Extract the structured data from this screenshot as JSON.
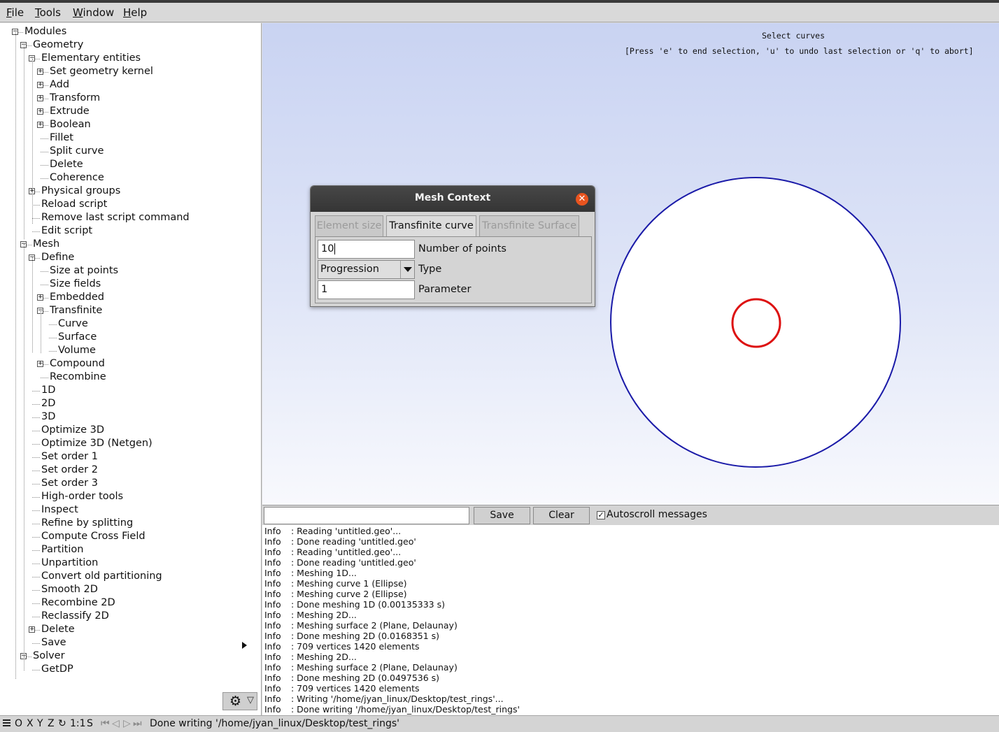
{
  "menu": [
    "File",
    "Tools",
    "Window",
    "Help"
  ],
  "tree": [
    {
      "label": "Modules",
      "depth": 0,
      "toggle": "minus"
    },
    {
      "label": "Geometry",
      "depth": 1,
      "toggle": "minus"
    },
    {
      "label": "Elementary entities",
      "depth": 2,
      "toggle": "minus"
    },
    {
      "label": "Set geometry kernel",
      "depth": 3,
      "toggle": "plus"
    },
    {
      "label": "Add",
      "depth": 3,
      "toggle": "plus"
    },
    {
      "label": "Transform",
      "depth": 3,
      "toggle": "plus"
    },
    {
      "label": "Extrude",
      "depth": 3,
      "toggle": "plus"
    },
    {
      "label": "Boolean",
      "depth": 3,
      "toggle": "plus"
    },
    {
      "label": "Fillet",
      "depth": 3,
      "toggle": ""
    },
    {
      "label": "Split curve",
      "depth": 3,
      "toggle": ""
    },
    {
      "label": "Delete",
      "depth": 3,
      "toggle": ""
    },
    {
      "label": "Coherence",
      "depth": 3,
      "toggle": ""
    },
    {
      "label": "Physical groups",
      "depth": 2,
      "toggle": "plus"
    },
    {
      "label": "Reload script",
      "depth": 2,
      "toggle": ""
    },
    {
      "label": "Remove last script command",
      "depth": 2,
      "toggle": ""
    },
    {
      "label": "Edit script",
      "depth": 2,
      "toggle": ""
    },
    {
      "label": "Mesh",
      "depth": 1,
      "toggle": "minus"
    },
    {
      "label": "Define",
      "depth": 2,
      "toggle": "minus"
    },
    {
      "label": "Size at points",
      "depth": 3,
      "toggle": ""
    },
    {
      "label": "Size fields",
      "depth": 3,
      "toggle": ""
    },
    {
      "label": "Embedded",
      "depth": 3,
      "toggle": "plus"
    },
    {
      "label": "Transfinite",
      "depth": 3,
      "toggle": "minus"
    },
    {
      "label": "Curve",
      "depth": 4,
      "toggle": ""
    },
    {
      "label": "Surface",
      "depth": 4,
      "toggle": ""
    },
    {
      "label": "Volume",
      "depth": 4,
      "toggle": ""
    },
    {
      "label": "Compound",
      "depth": 3,
      "toggle": "plus"
    },
    {
      "label": "Recombine",
      "depth": 3,
      "toggle": ""
    },
    {
      "label": "1D",
      "depth": 2,
      "toggle": ""
    },
    {
      "label": "2D",
      "depth": 2,
      "toggle": ""
    },
    {
      "label": "3D",
      "depth": 2,
      "toggle": ""
    },
    {
      "label": "Optimize 3D",
      "depth": 2,
      "toggle": ""
    },
    {
      "label": "Optimize 3D (Netgen)",
      "depth": 2,
      "toggle": ""
    },
    {
      "label": "Set order 1",
      "depth": 2,
      "toggle": ""
    },
    {
      "label": "Set order 2",
      "depth": 2,
      "toggle": ""
    },
    {
      "label": "Set order 3",
      "depth": 2,
      "toggle": ""
    },
    {
      "label": "High-order tools",
      "depth": 2,
      "toggle": ""
    },
    {
      "label": "Inspect",
      "depth": 2,
      "toggle": ""
    },
    {
      "label": "Refine by splitting",
      "depth": 2,
      "toggle": ""
    },
    {
      "label": "Compute Cross Field",
      "depth": 2,
      "toggle": ""
    },
    {
      "label": "Partition",
      "depth": 2,
      "toggle": ""
    },
    {
      "label": "Unpartition",
      "depth": 2,
      "toggle": ""
    },
    {
      "label": "Convert old partitioning",
      "depth": 2,
      "toggle": ""
    },
    {
      "label": "Smooth 2D",
      "depth": 2,
      "toggle": ""
    },
    {
      "label": "Recombine 2D",
      "depth": 2,
      "toggle": ""
    },
    {
      "label": "Reclassify 2D",
      "depth": 2,
      "toggle": ""
    },
    {
      "label": "Delete",
      "depth": 2,
      "toggle": "plus"
    },
    {
      "label": "Save",
      "depth": 2,
      "toggle": ""
    },
    {
      "label": "Solver",
      "depth": 1,
      "toggle": "minus"
    },
    {
      "label": "GetDP",
      "depth": 2,
      "toggle": ""
    }
  ],
  "viewport": {
    "select_message": "Select curves",
    "select_hint": "[Press 'e' to end selection, 'u' to undo last selection or 'q' to abort]",
    "colors": {
      "mesh": "#f2a61c",
      "outer_curve": "#1a1aa8",
      "inner_curve": "#dd1111",
      "surface": "#ffffff"
    }
  },
  "dialog": {
    "title": "Mesh Context",
    "tabs": [
      "Element size",
      "Transfinite curve",
      "Transfinite Surface"
    ],
    "active_tab": 1,
    "fields": {
      "points_value": "10",
      "points_label": "Number of points",
      "type_value": "Progression",
      "type_label": "Type",
      "param_value": "1",
      "param_label": "Parameter"
    }
  },
  "messages_toolbar": {
    "search_value": "",
    "save_label": "Save",
    "clear_label": "Clear",
    "autoscroll_label": "Autoscroll messages",
    "autoscroll_checked": true
  },
  "messages": [
    {
      "level": "Info",
      "text": ": Reading 'untitled.geo'..."
    },
    {
      "level": "Info",
      "text": ": Done reading 'untitled.geo'"
    },
    {
      "level": "Info",
      "text": ": Reading 'untitled.geo'..."
    },
    {
      "level": "Info",
      "text": ": Done reading 'untitled.geo'"
    },
    {
      "level": "Info",
      "text": ": Meshing 1D..."
    },
    {
      "level": "Info",
      "text": ": Meshing curve 1 (Ellipse)"
    },
    {
      "level": "Info",
      "text": ": Meshing curve 2 (Ellipse)"
    },
    {
      "level": "Info",
      "text": ": Done meshing 1D (0.00135333 s)"
    },
    {
      "level": "Info",
      "text": ": Meshing 2D..."
    },
    {
      "level": "Info",
      "text": ": Meshing surface 2 (Plane, Delaunay)"
    },
    {
      "level": "Info",
      "text": ": Done meshing 2D (0.0168351 s)"
    },
    {
      "level": "Info",
      "text": ": 709 vertices 1420 elements"
    },
    {
      "level": "Info",
      "text": ": Meshing 2D..."
    },
    {
      "level": "Info",
      "text": ": Meshing surface 2 (Plane, Delaunay)"
    },
    {
      "level": "Info",
      "text": ": Done meshing 2D (0.0497536 s)"
    },
    {
      "level": "Info",
      "text": ": 709 vertices 1420 elements"
    },
    {
      "level": "Info",
      "text": ": Writing '/home/jyan_linux/Desktop/test_rings'..."
    },
    {
      "level": "Info",
      "text": ": Done writing '/home/jyan_linux/Desktop/test_rings'"
    }
  ],
  "statusbar": {
    "axes": [
      "O",
      "X",
      "Y",
      "Z"
    ],
    "scale": "1:1",
    "s": "S",
    "message": "Done writing '/home/jyan_linux/Desktop/test_rings'"
  }
}
